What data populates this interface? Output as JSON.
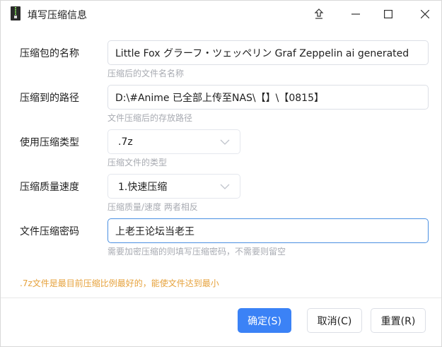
{
  "window": {
    "title": "填写压缩信息",
    "controls": [
      "pin-icon",
      "minimize-icon",
      "maximize-icon",
      "close-icon"
    ]
  },
  "form": {
    "archive_name": {
      "label": "压缩包的名称",
      "value": "Little Fox グラーフ・ツェッペリン Graf Zeppelin ai generated",
      "hint": "压缩后的文件名名称"
    },
    "archive_path": {
      "label": "压缩到的路径",
      "value": "D:\\#Anime 已全部上传至NAS\\【】\\【0815】",
      "hint": "文件压缩后的存放路径"
    },
    "compress_type": {
      "label": "使用压缩类型",
      "value": ".7z",
      "hint": "压缩文件的类型"
    },
    "compress_speed": {
      "label": "压缩质量速度",
      "value": "1.快速压缩",
      "hint": "压缩质量/速度 两者相反"
    },
    "password": {
      "label": "文件压缩密码",
      "value": "上老王论坛当老王",
      "hint": "需要加密压缩的则填写压缩密码，不需要则留空"
    }
  },
  "note": ".7z文件是最目前压缩比例最好的，能使文件达到最小",
  "buttons": {
    "ok": "确定(S)",
    "cancel": "取消(C)",
    "reset": "重置(R)"
  },
  "colors": {
    "primary": "#3b82f6",
    "note": "#e6a23c",
    "hint": "#a8abb2",
    "focus_border": "#4a90e2"
  }
}
